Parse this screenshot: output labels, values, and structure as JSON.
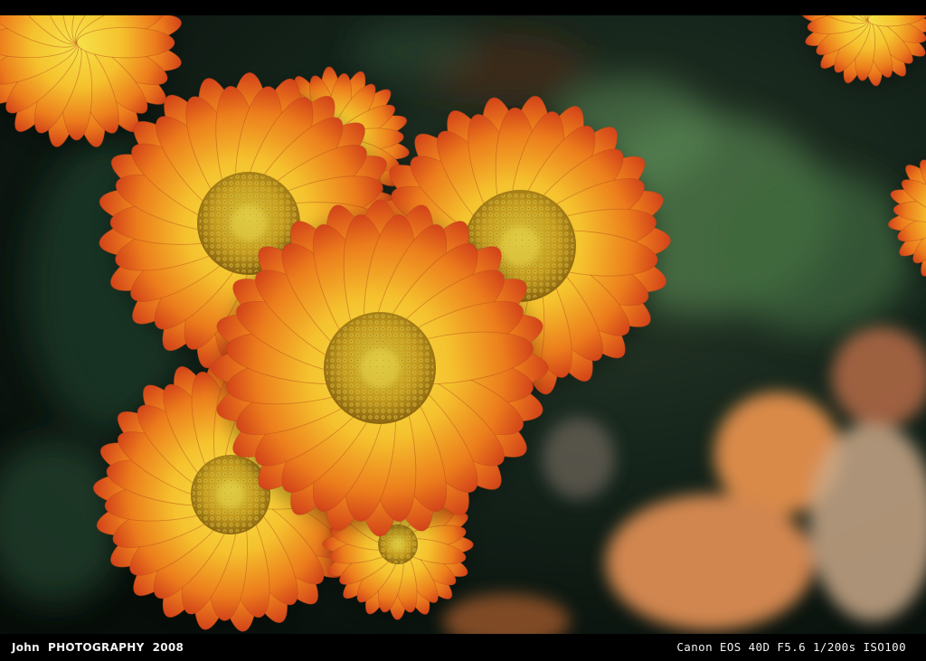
{
  "photo": {
    "subject": "orange-yellow-daisy-flowers",
    "colors": {
      "petal_yellow": "#f7d83a",
      "petal_orange": "#e8681a",
      "petal_red": "#c8361a",
      "center": "#c99a1c",
      "foliage": "#2f5a3a",
      "background": "#0f1a14",
      "blur_peach": "#d88a50"
    }
  },
  "caption": {
    "author": "John",
    "studio": "PHOTOGRAPHY",
    "year": "2008",
    "camera_info": "Canon EOS 40D F5.6 1/200s ISO100"
  }
}
